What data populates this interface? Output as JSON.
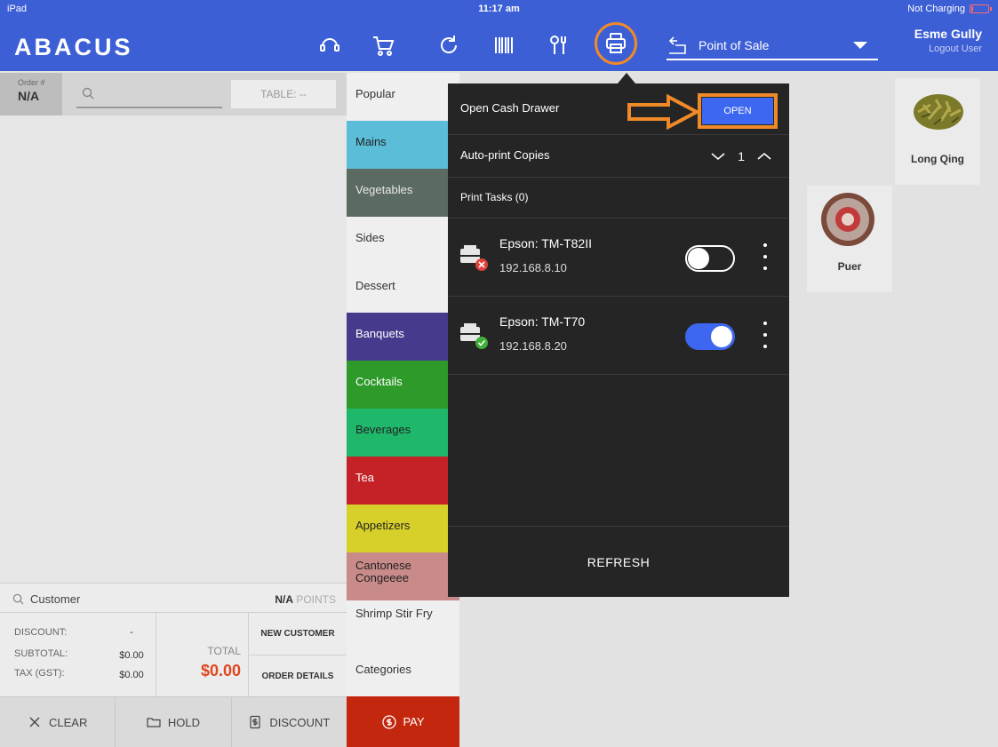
{
  "status_bar": {
    "device": "iPad",
    "time": "11:17 am",
    "battery": "Not Charging"
  },
  "header": {
    "logo": "ABACUS",
    "mode": "Point of Sale",
    "user_name": "Esme Gully",
    "logout": "Logout User",
    "accent": "#3d5fd6"
  },
  "order": {
    "order_label": "Order #",
    "order_number": "N/A",
    "table": "TABLE: --",
    "customer": "Customer",
    "points_value": "N/A",
    "points_label": "POINTS",
    "discount_label": "DISCOUNT:",
    "discount_value": "-",
    "subtotal_label": "SUBTOTAL:",
    "subtotal_value": "$0.00",
    "tax_label": "TAX (GST):",
    "tax_value": "$0.00",
    "total_label": "TOTAL",
    "total_value": "$0.00",
    "new_customer": "NEW CUSTOMER",
    "order_details": "ORDER DETAILS",
    "clear": "CLEAR",
    "hold": "HOLD",
    "discount_btn": "DISCOUNT",
    "pay": "PAY"
  },
  "categories": [
    {
      "label": "Popular",
      "bg": "#efefef",
      "fg": "#333333"
    },
    {
      "label": "Mains",
      "bg": "#5bbdd8",
      "fg": "#222222"
    },
    {
      "label": "Vegetables",
      "bg": "#5b6b62",
      "fg": "#e8e8e8"
    },
    {
      "label": "Sides",
      "bg": "#efefef",
      "fg": "#333333"
    },
    {
      "label": "Dessert",
      "bg": "#efefef",
      "fg": "#333333"
    },
    {
      "label": "Banquets",
      "bg": "#463a8c",
      "fg": "#ffffff"
    },
    {
      "label": "Cocktails",
      "bg": "#2e9a2a",
      "fg": "#ffffff"
    },
    {
      "label": "Beverages",
      "bg": "#1fb86b",
      "fg": "#222222"
    },
    {
      "label": "Tea",
      "bg": "#c42226",
      "fg": "#ffffff"
    },
    {
      "label": "Appetizers",
      "bg": "#d8d02a",
      "fg": "#222222"
    },
    {
      "label": "Cantonese Congeeee",
      "bg": "#c98a8a",
      "fg": "#222222"
    },
    {
      "label": "Shrimp Stir Fry",
      "bg": "#efefef",
      "fg": "#333333"
    },
    {
      "label": "Categories",
      "bg": "#efefef",
      "fg": "#333333"
    }
  ],
  "products": [
    {
      "label": "Long Qing"
    },
    {
      "label": "Puer"
    }
  ],
  "printer_popover": {
    "open_drawer_label": "Open Cash Drawer",
    "open_button": "OPEN",
    "auto_print_label": "Auto-print Copies",
    "copies": "1",
    "print_tasks": "Print Tasks (0)",
    "printers": [
      {
        "name": "Epson: TM-T82II",
        "ip": "192.168.8.10",
        "enabled": false,
        "status": "error"
      },
      {
        "name": "Epson: TM-T70",
        "ip": "192.168.8.20",
        "enabled": true,
        "status": "ok"
      }
    ],
    "refresh": "REFRESH",
    "highlight_color": "#f08a28"
  }
}
